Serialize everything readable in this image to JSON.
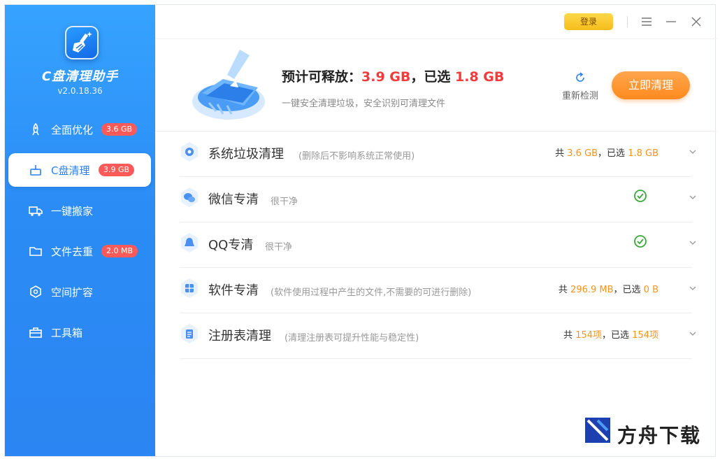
{
  "app": {
    "name": "C盘清理助手",
    "version": "v2.0.18.36"
  },
  "titlebar": {
    "login_label": "登录"
  },
  "sidebar": {
    "items": [
      {
        "label": "全面优化",
        "badge": "3.6 GB",
        "icon": "rocket-icon"
      },
      {
        "label": "C盘清理",
        "badge": "3.9 GB",
        "icon": "clean-icon"
      },
      {
        "label": "一键搬家",
        "badge": "",
        "icon": "truck-icon"
      },
      {
        "label": "文件去重",
        "badge": "2.0 MB",
        "icon": "folder-icon"
      },
      {
        "label": "空间扩容",
        "badge": "",
        "icon": "cube-icon"
      },
      {
        "label": "工具箱",
        "badge": "",
        "icon": "toolbox-icon"
      }
    ]
  },
  "header": {
    "title_prefix": "预计可释放：",
    "release_size": "3.9 GB",
    "title_mid": "，已选",
    "selected_size": "1.8 GB",
    "subtitle": "一键安全清理垃圾，安全识别可清理文件",
    "rescan_label": "重新检测",
    "clean_label": "立即清理"
  },
  "rows": [
    {
      "title": "系统垃圾清理",
      "desc": "(删除后不影响系统正常使用)",
      "stat_a": "共 ",
      "stat_b": "3.6 GB",
      "stat_c": "，已选 ",
      "stat_d": "1.8 GB",
      "icon": "gear-icon"
    },
    {
      "title": "微信专清",
      "desc": "很干净",
      "icon": "wechat-icon"
    },
    {
      "title": "QQ专清",
      "desc": "很干净",
      "icon": "qq-icon"
    },
    {
      "title": "软件专清",
      "desc": "(软件使用过程中产生的文件,不需要的可进行删除)",
      "stat_a": "共 ",
      "stat_b": "296.9 MB",
      "stat_c": "，已选 ",
      "stat_d": "0 B",
      "icon": "app-icon"
    },
    {
      "title": "注册表清理",
      "desc": "(清理注册表可提升性能与稳定性)",
      "stat_a": "共 ",
      "stat_b": "154项",
      "stat_c": "，已选 ",
      "stat_d": "154项",
      "icon": "registry-icon"
    }
  ],
  "watermark": {
    "text": "方舟下载"
  },
  "colors": {
    "sidebar": "#2b8cf5",
    "accent": "#ff8a1f",
    "danger": "#f23b3b",
    "success": "#39a83a"
  }
}
